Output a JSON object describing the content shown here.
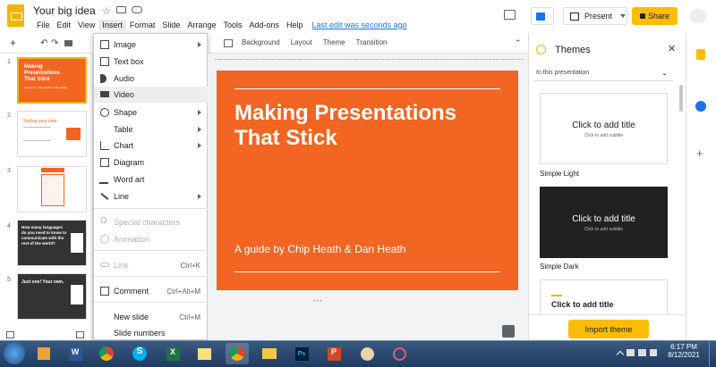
{
  "header": {
    "doc_title": "Your big idea",
    "menus": [
      "File",
      "Edit",
      "View",
      "Insert",
      "Format",
      "Slide",
      "Arrange",
      "Tools",
      "Add-ons",
      "Help"
    ],
    "last_edit": "Last edit was seconds ago",
    "present_label": "Present",
    "share_label": "Share"
  },
  "toolbar": {
    "background": "Background",
    "layout": "Layout",
    "theme": "Theme",
    "transition": "Transition"
  },
  "insert_menu": {
    "items": [
      {
        "label": "Image",
        "icon": "image-icon",
        "submenu": true
      },
      {
        "label": "Text box",
        "icon": "text-box-icon"
      },
      {
        "label": "Audio",
        "icon": "audio-icon"
      },
      {
        "label": "Video",
        "icon": "video-icon",
        "highlighted": true
      },
      {
        "label": "Shape",
        "icon": "shape-icon",
        "submenu": true
      },
      {
        "label": "Table",
        "submenu": true
      },
      {
        "label": "Chart",
        "icon": "chart-icon",
        "submenu": true
      },
      {
        "label": "Diagram",
        "icon": "diagram-icon"
      },
      {
        "label": "Word art",
        "icon": "word-art-icon"
      },
      {
        "label": "Line",
        "icon": "line-icon",
        "submenu": true
      },
      {
        "label": "Special characters",
        "icon": "omega-icon",
        "disabled": true
      },
      {
        "label": "Animation",
        "icon": "animation-icon",
        "disabled": true
      },
      {
        "label": "Link",
        "icon": "link-icon",
        "shortcut": "Ctrl+K",
        "disabled": true
      },
      {
        "label": "Comment",
        "icon": "comment-icon",
        "shortcut": "Ctrl+Alt+M"
      },
      {
        "label": "New slide",
        "shortcut": "Ctrl+M"
      },
      {
        "label": "Slide numbers"
      }
    ]
  },
  "filmstrip": {
    "numbers": [
      "1",
      "2",
      "3",
      "4",
      "5"
    ],
    "thumbs": [
      {
        "title": "Making Presentations That Stick",
        "sub": "A guide by Chip Heath & Dan Heath"
      },
      {
        "title": "Setting your idea"
      },
      {
        "title": ""
      },
      {
        "title": "How many languages do you need to know to communicate with the rest of the world?"
      },
      {
        "title": "Just one! Your own."
      }
    ]
  },
  "slide": {
    "title": "Making Presentations That Stick",
    "subtitle": "A guide by Chip Heath & Dan Heath",
    "bg_color": "#f26522"
  },
  "themes_panel": {
    "title": "Themes",
    "dropdown": "In this presentation",
    "cards": [
      {
        "title": "Click to add title",
        "subtitle": "Click to add subtitle",
        "name": "Simple Light"
      },
      {
        "title": "Click to add title",
        "subtitle": "Click to add subtitle",
        "name": "Simple Dark"
      },
      {
        "title": "Click to add title"
      }
    ],
    "import_label": "Import theme"
  },
  "taskbar": {
    "time": "6:17 PM",
    "date": "8/12/2021"
  }
}
